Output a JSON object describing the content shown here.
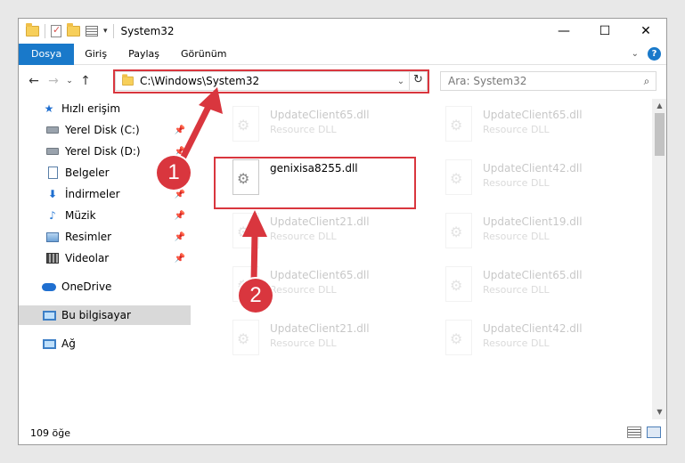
{
  "window": {
    "title": "System32",
    "controls": {
      "minimize": "—",
      "maximize": "☐",
      "close": "✕"
    }
  },
  "ribbon": {
    "tabs": [
      "Dosya",
      "Giriş",
      "Paylaş",
      "Görünüm"
    ]
  },
  "nav": {
    "back": "←",
    "forward": "→",
    "recent": "⌄",
    "up": "↑",
    "address": "C:\\Windows\\System32",
    "address_dropdown": "⌄",
    "refresh": "↻",
    "search_placeholder": "Ara: System32",
    "search_icon": "⌕"
  },
  "sidebar": {
    "items": [
      {
        "label": "Hızlı erişim",
        "icon": "star-icon",
        "pinned": false
      },
      {
        "label": "Yerel Disk (C:)",
        "icon": "drive-icon",
        "pinned": true
      },
      {
        "label": "Yerel Disk (D:)",
        "icon": "drive-icon",
        "pinned": true
      },
      {
        "label": "Belgeler",
        "icon": "documents-icon",
        "pinned": true
      },
      {
        "label": "İndirmeler",
        "icon": "downloads-icon",
        "pinned": true
      },
      {
        "label": "Müzik",
        "icon": "music-icon",
        "pinned": true
      },
      {
        "label": "Resimler",
        "icon": "pictures-icon",
        "pinned": true
      },
      {
        "label": "Videolar",
        "icon": "videos-icon",
        "pinned": true
      },
      {
        "label": "OneDrive",
        "icon": "onedrive-icon",
        "pinned": false
      },
      {
        "label": "Bu bilgisayar",
        "icon": "this-pc-icon",
        "pinned": false,
        "selected": true
      },
      {
        "label": "Ağ",
        "icon": "network-icon",
        "pinned": false
      }
    ]
  },
  "files": [
    {
      "name": "UpdateClient65.dll",
      "type": "Resource DLL",
      "faded": true
    },
    {
      "name": "UpdateClient65.dll",
      "type": "Resource DLL",
      "faded": true
    },
    {
      "name": "genixisa8255.dll",
      "type": "",
      "faded": false,
      "highlighted": true
    },
    {
      "name": "UpdateClient42.dll",
      "type": "Resource DLL",
      "faded": true
    },
    {
      "name": "UpdateClient21.dll",
      "type": "Resource DLL",
      "faded": true
    },
    {
      "name": "UpdateClient19.dll",
      "type": "Resource DLL",
      "faded": true
    },
    {
      "name": "UpdateClient65.dll",
      "type": "Resource DLL",
      "faded": true
    },
    {
      "name": "UpdateClient65.dll",
      "type": "Resource DLL",
      "faded": true
    },
    {
      "name": "UpdateClient21.dll",
      "type": "Resource DLL",
      "faded": true
    },
    {
      "name": "UpdateClient42.dll",
      "type": "Resource DLL",
      "faded": true
    }
  ],
  "status": {
    "item_count": "109 öğe"
  },
  "annotations": {
    "step1": "1",
    "step2": "2"
  },
  "colors": {
    "accent": "#1979ca",
    "annotation": "#d9363e"
  }
}
